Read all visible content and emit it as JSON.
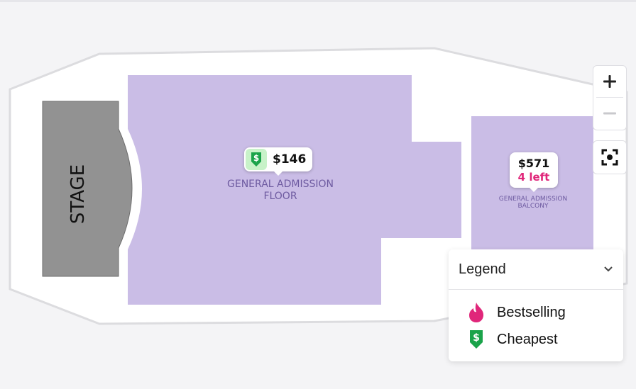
{
  "stage": {
    "label": "STAGE"
  },
  "sections": {
    "floor": {
      "name_line1": "GENERAL ADMISSION",
      "name_line2": "FLOOR",
      "price": "$146",
      "color": "#cabde6"
    },
    "balcony": {
      "name_line1": "GENERAL ADMISSION",
      "name_line2": "BALCONY",
      "price": "$571",
      "availability": "4 left",
      "color": "#cabde6"
    }
  },
  "controls": {
    "zoom_in_icon": "plus-icon",
    "zoom_out_icon": "minus-icon",
    "recenter_icon": "focus-icon"
  },
  "legend": {
    "title": "Legend",
    "items": [
      {
        "label": "Bestselling",
        "icon": "flame-icon",
        "color": "#e0267a"
      },
      {
        "label": "Cheapest",
        "icon": "dollar-down-icon",
        "color": "#1aa34a"
      }
    ]
  }
}
